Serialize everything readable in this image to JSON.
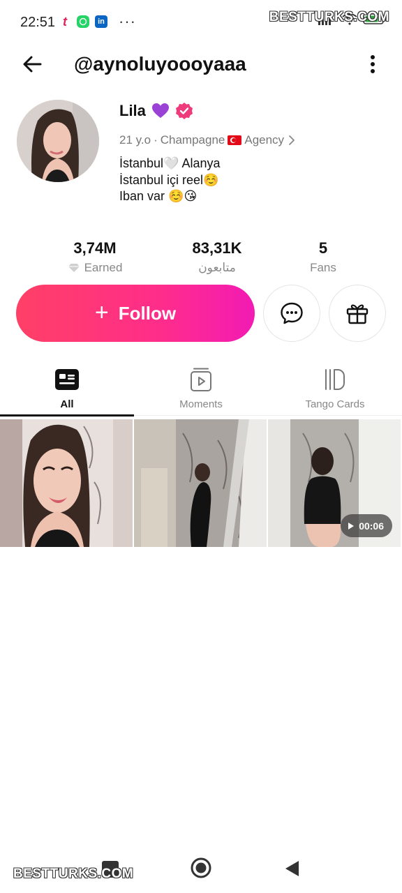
{
  "status_bar": {
    "time": "22:51",
    "app_icons": [
      "tango-icon",
      "whatsapp-icon",
      "linkedin-icon"
    ],
    "overflow_dots": "···",
    "watermark": "BESTTURKS.COM"
  },
  "header": {
    "username": "@aynoluyoooyaaa"
  },
  "profile": {
    "name": "Lila",
    "age": "21 y.o",
    "separator": "·",
    "level": "Champagne",
    "agency": "Agency",
    "bio": "İstanbul🤍 Alanya\nİstanbul içi reel☺️\nIban var ☺️😘"
  },
  "stats": [
    {
      "value": "3,74M",
      "label": "Earned"
    },
    {
      "value": "83,31K",
      "label": "متابعون"
    },
    {
      "value": "5",
      "label": "Fans"
    }
  ],
  "actions": {
    "follow_label": "Follow",
    "follow_plus": "+"
  },
  "tabs": [
    {
      "label": "All",
      "active": true
    },
    {
      "label": "Moments",
      "active": false
    },
    {
      "label": "Tango Cards",
      "active": false
    }
  ],
  "media": [
    {
      "type": "photo"
    },
    {
      "type": "photo"
    },
    {
      "type": "video",
      "duration": "00:06"
    }
  ],
  "footer": {
    "watermark": "BESTTURKS.COM"
  },
  "colors": {
    "follow_gradient_start": "#ff4066",
    "follow_gradient_end": "#f21bb4",
    "verified": "#ee3b7b",
    "text_primary": "#111111",
    "text_secondary": "#888888"
  }
}
